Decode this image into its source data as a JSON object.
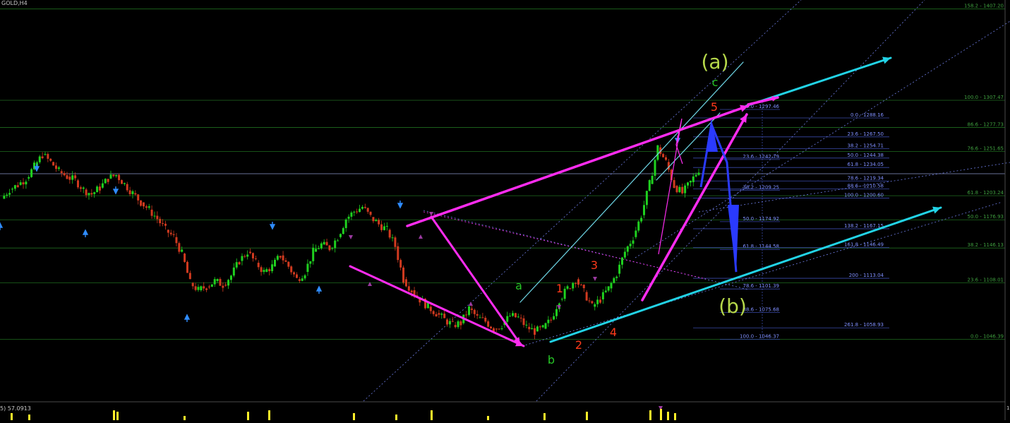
{
  "window": {
    "symbol_label": "GOLD,H4",
    "indicator_label": "5) 57.0913",
    "indicator_scale_top": "10"
  },
  "colors": {
    "background": "#000000",
    "grid_green": "#1f6b1f",
    "fib_green_text": "#3f9f3f",
    "fib_blue_line": "#3a4aa8",
    "fib_blue_text": "#7f8fff",
    "magenta": "#ff2cf0",
    "cyan": "#22d3e6",
    "cyan_channel": "#6fd8e8",
    "dotted_blue": "#7b8cff",
    "arrow_blue": "#2a3aff",
    "wave_green": "#26c626",
    "wave_red": "#ff3a1a",
    "big_wave": "#b6d84a",
    "candle_up": "#1fd11f",
    "candle_down": "#d13a1f",
    "marker_blue": "#2f8cff",
    "marker_purple": "#9a3aa0",
    "indicator_yellow": "#ffef2a"
  },
  "chart_data": {
    "type": "candlestick",
    "symbol": "GOLD",
    "timeframe": "H4",
    "ylim": [
      1030,
      1410
    ],
    "fib_right_levels": [
      {
        "label": "158.2 - 1407.20",
        "value": 1407.2
      },
      {
        "label": "100.0 - 1307.47",
        "value": 1307.47
      },
      {
        "label": "86.6 - 1277.73",
        "value": 1277.73
      },
      {
        "label": "76.6 - 1251.65",
        "value": 1251.65
      },
      {
        "label": "61.8 - 1203.24",
        "value": 1203.24
      },
      {
        "label": "50.0 - 1176.93",
        "value": 1176.93
      },
      {
        "label": "38.2 - 1146.13",
        "value": 1146.13
      },
      {
        "label": "23.6 - 1108.01",
        "value": 1108.01
      },
      {
        "label": "0.0 - 1046.39",
        "value": 1046.39
      }
    ],
    "fib_set_a": [
      {
        "label": "0.0 - 1297.46",
        "value": 1297.46
      },
      {
        "label": "23.6 - 1242.79",
        "value": 1242.79
      },
      {
        "label": "38.2 - 1209.25",
        "value": 1209.25
      },
      {
        "label": "50.0 - 1174.92",
        "value": 1174.92
      },
      {
        "label": "61.8 - 1144.58",
        "value": 1144.58
      },
      {
        "label": "78.6 - 1101.39",
        "value": 1101.39
      },
      {
        "label": "88.6 - 1075.68",
        "value": 1075.68
      },
      {
        "label": "100.0 - 1046.37",
        "value": 1046.37
      }
    ],
    "fib_set_b": [
      {
        "label": "0.0 - 1288.16",
        "value": 1288.16
      },
      {
        "label": "23.6 - 1267.50",
        "value": 1267.5
      },
      {
        "label": "38.2 - 1254.71",
        "value": 1254.71
      },
      {
        "label": "50.0 - 1244.38",
        "value": 1244.38
      },
      {
        "label": "61.8 - 1234.05",
        "value": 1234.05
      },
      {
        "label": "78.6 - 1219.34",
        "value": 1219.34
      },
      {
        "label": "88.6 - 1210.58",
        "value": 1210.58
      },
      {
        "label": "100.0 - 1200.60",
        "value": 1200.6
      },
      {
        "label": "138.2 - 1167.15",
        "value": 1167.15
      },
      {
        "label": "161.8 - 1146.49",
        "value": 1146.49
      },
      {
        "label": "200 - 1113.04",
        "value": 1113.04
      },
      {
        "label": "261.8 - 1058.93",
        "value": 1058.93
      }
    ],
    "wave_labels": [
      {
        "text": "(a)",
        "color": "big"
      },
      {
        "text": "(b)",
        "color": "big"
      },
      {
        "text": "a",
        "color": "green"
      },
      {
        "text": "b",
        "color": "green"
      },
      {
        "text": "c",
        "color": "green"
      },
      {
        "text": "1",
        "color": "red"
      },
      {
        "text": "2",
        "color": "red"
      },
      {
        "text": "3",
        "color": "red"
      },
      {
        "text": "4",
        "color": "red"
      },
      {
        "text": "5",
        "color": "red"
      }
    ],
    "price_path": [
      1200,
      1210,
      1215,
      1222,
      1235,
      1248,
      1240,
      1230,
      1224,
      1220,
      1210,
      1205,
      1212,
      1222,
      1226,
      1216,
      1206,
      1196,
      1188,
      1178,
      1166,
      1158,
      1140,
      1108,
      1100,
      1104,
      1110,
      1106,
      1116,
      1132,
      1142,
      1130,
      1120,
      1126,
      1138,
      1126,
      1112,
      1120,
      1142,
      1150,
      1146,
      1158,
      1178,
      1186,
      1191,
      1180,
      1172,
      1166,
      1148,
      1112,
      1100,
      1090,
      1082,
      1075,
      1068,
      1062,
      1064,
      1080,
      1070,
      1066,
      1058,
      1062,
      1072,
      1070,
      1060,
      1055,
      1058,
      1068,
      1090,
      1102,
      1112,
      1098,
      1082,
      1090,
      1102,
      1118,
      1142,
      1158,
      1182,
      1216,
      1256,
      1240,
      1214,
      1206,
      1218,
      1232
    ]
  }
}
